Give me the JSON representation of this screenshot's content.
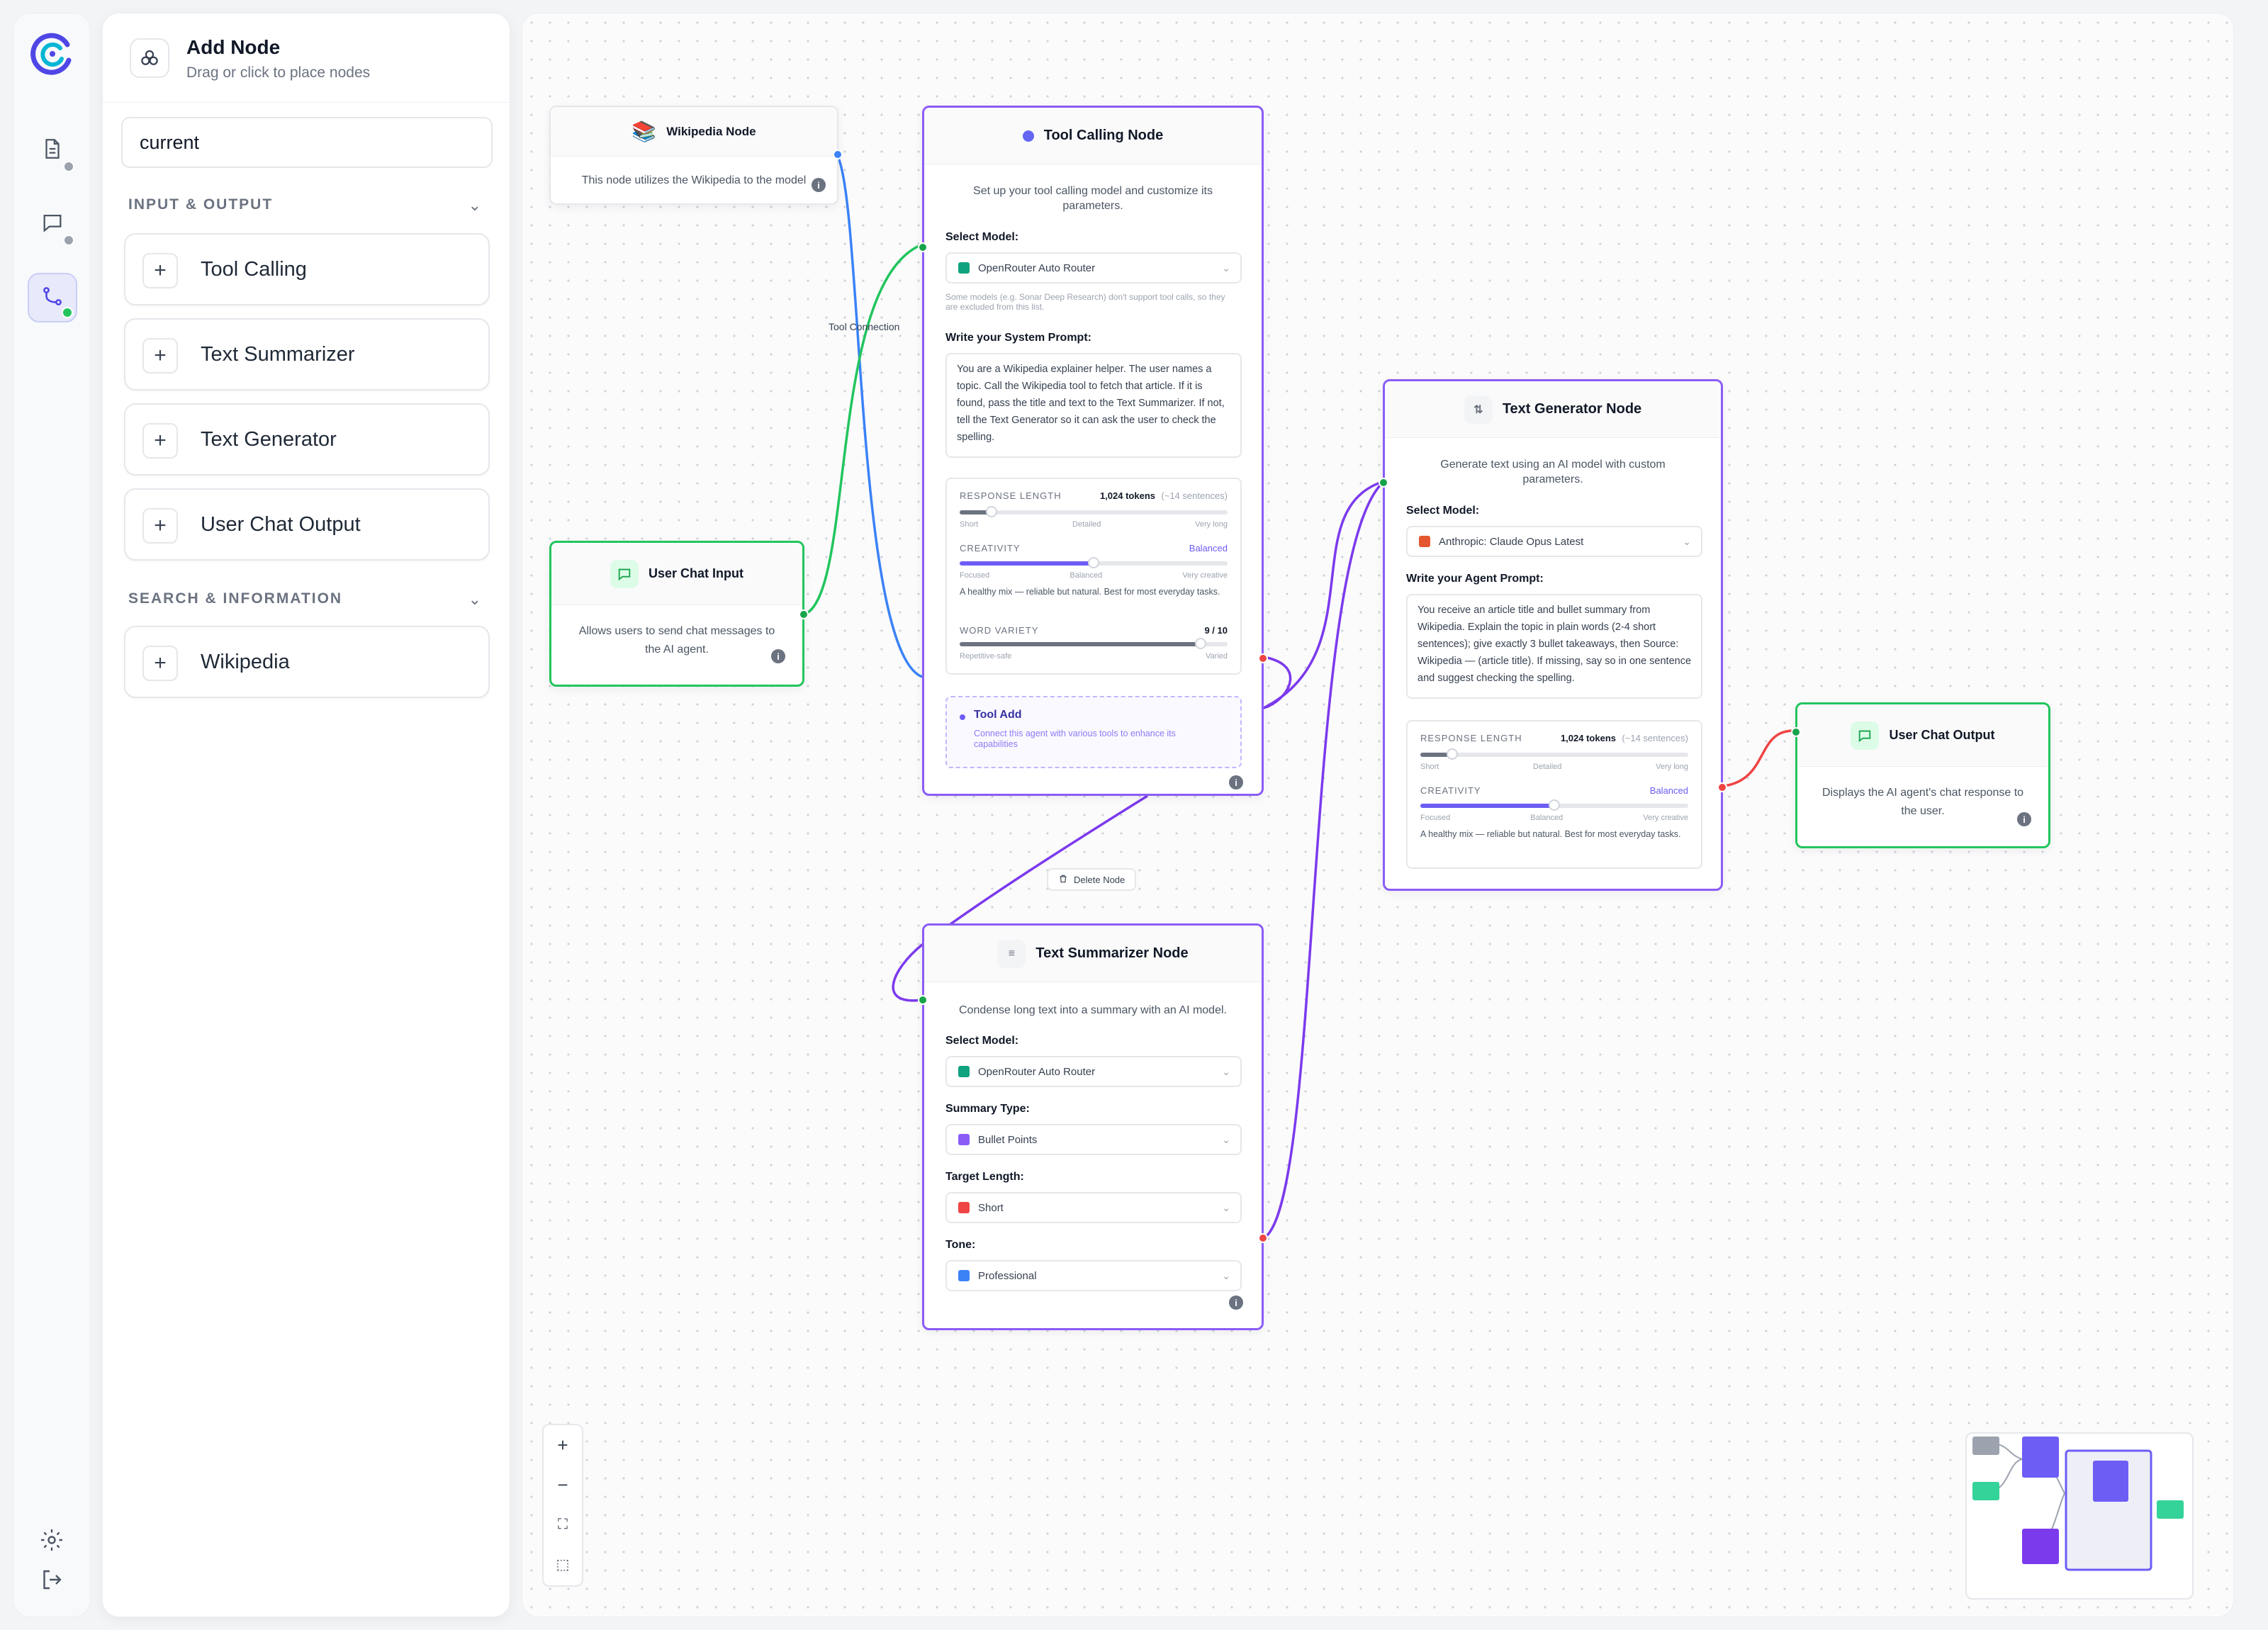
{
  "rail": {
    "items": [
      {
        "icon": "document-icon"
      },
      {
        "icon": "chat-icon"
      },
      {
        "icon": "workflow-icon",
        "active": true
      }
    ],
    "bottom": [
      {
        "icon": "gear-icon"
      },
      {
        "icon": "logout-icon"
      }
    ]
  },
  "panel": {
    "title": "Add Node",
    "subtitle": "Drag or click to place nodes",
    "search_value": "current",
    "sections": [
      {
        "label": "INPUT & OUTPUT",
        "items": [
          "Tool Calling",
          "Text Summarizer",
          "Text Generator",
          "User Chat Output"
        ]
      },
      {
        "label": "SEARCH & INFORMATION",
        "items": [
          "Wikipedia"
        ]
      }
    ]
  },
  "canvas": {
    "wire_label": "Tool Connection",
    "delete_label": "Delete Node",
    "nodes": {
      "wikipedia": {
        "title": "Wikipedia Node",
        "desc": "This node utilizes the Wikipedia to the model"
      },
      "chat_input": {
        "title": "User Chat Input",
        "desc": "Allows users to send chat messages to the AI agent."
      },
      "tool_calling": {
        "title": "Tool Calling Node",
        "desc": "Set up your tool calling model and customize its parameters.",
        "select_label": "Select Model:",
        "model": "OpenRouter Auto Router",
        "model_color": "#10a37f",
        "model_note": "Some models (e.g. Sonar Deep Research) don't support tool calls, so they are excluded from this list.",
        "prompt_label": "Write your System Prompt:",
        "prompt": "You are a Wikipedia explainer helper. The user names a topic. Call the Wikipedia tool to fetch that article. If it is found, pass the title and text to the Text Summarizer. If not, tell the Text Generator so it can ask the user to check the spelling.",
        "response_length": {
          "label": "RESPONSE LENGTH",
          "value": "1,024 tokens",
          "hint": "(~14 sentences)",
          "level": 0.12,
          "ticks": [
            "Short",
            "Detailed",
            "Very long"
          ]
        },
        "creativity": {
          "label": "CREATIVITY",
          "value": "Balanced",
          "level": 0.5,
          "ticks": [
            "Focused",
            "Balanced",
            "Very creative"
          ],
          "help": "A healthy mix — reliable but natural. Best for most everyday tasks."
        },
        "word_variety": {
          "label": "WORD VARIETY",
          "value": "9 / 10",
          "level": 0.9,
          "ticks": [
            "Repetitive-safe",
            "Varied"
          ]
        },
        "tool_add": {
          "title": "Tool Add",
          "desc": "Connect this agent with various tools to enhance its capabilities"
        }
      },
      "text_generator": {
        "title": "Text Generator Node",
        "desc": "Generate text using an AI model with custom parameters.",
        "select_label": "Select Model:",
        "model": "Anthropic: Claude Opus Latest",
        "model_color": "#e4572e",
        "prompt_label": "Write your Agent Prompt:",
        "prompt": "You receive an article title and bullet summary from Wikipedia. Explain the topic in plain words (2-4 short sentences); give exactly 3 bullet takeaways, then Source: Wikipedia — (article title). If missing, say so in one sentence and suggest checking the spelling.",
        "response_length": {
          "label": "RESPONSE LENGTH",
          "value": "1,024 tokens",
          "hint": "(~14 sentences)",
          "level": 0.12,
          "ticks": [
            "Short",
            "Detailed",
            "Very long"
          ]
        },
        "creativity": {
          "label": "CREATIVITY",
          "value": "Balanced",
          "level": 0.5,
          "ticks": [
            "Focused",
            "Balanced",
            "Very creative"
          ],
          "help": "A healthy mix — reliable but natural. Best for most everyday tasks."
        }
      },
      "summarizer": {
        "title": "Text Summarizer Node",
        "desc": "Condense long text into a summary with an AI model.",
        "model_label": "Select Model:",
        "model": "OpenRouter Auto Router",
        "model_color": "#10a37f",
        "type_label": "Summary Type:",
        "type": "Bullet Points",
        "type_color": "#8b5cf6",
        "length_label": "Target Length:",
        "length": "Short",
        "length_color": "#ef4444",
        "tone_label": "Tone:",
        "tone": "Professional",
        "tone_color": "#3b82f6"
      },
      "chat_output": {
        "title": "User Chat Output",
        "desc": "Displays the AI agent's chat response to the user."
      }
    },
    "zoom_controls": [
      "+",
      "−",
      "⛶",
      "⬚"
    ]
  },
  "colors": {
    "accent": "#6d5df5",
    "purple_border": "#8b5cf6",
    "green_border": "#22c55e"
  }
}
